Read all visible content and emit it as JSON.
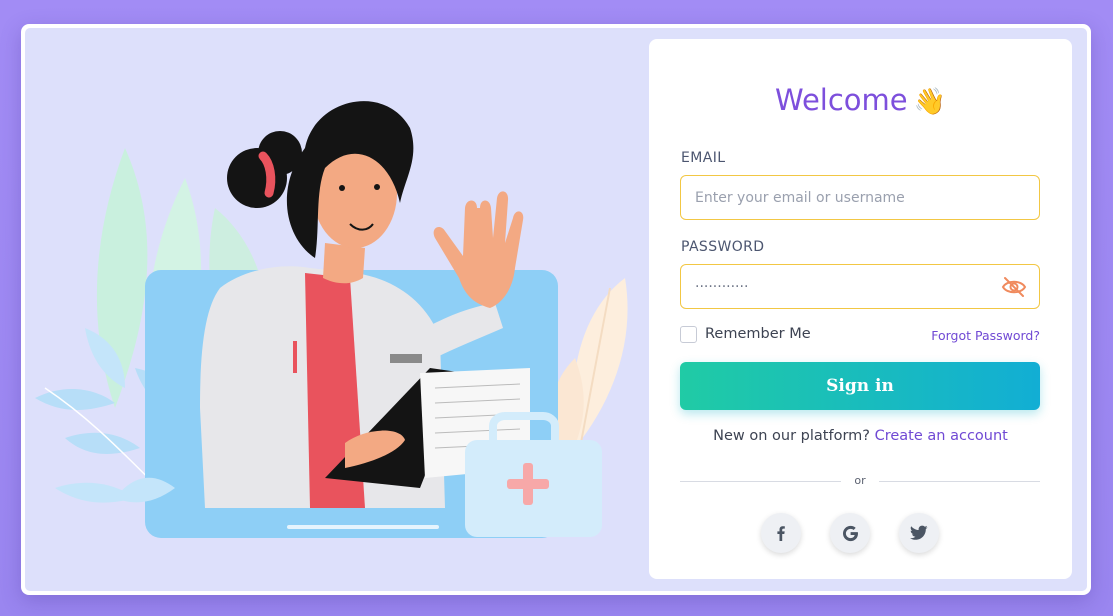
{
  "title": "Welcome",
  "title_emoji": "👋",
  "email": {
    "label": "EMAIL",
    "placeholder": "Enter your email or username",
    "value": ""
  },
  "password": {
    "label": "PASSWORD",
    "value": "············"
  },
  "remember_label": "Remember Me",
  "forgot_label": "Forgot Password?",
  "signin_label": "Sign in",
  "signup": {
    "prompt": "New on our platform?",
    "link": "Create an account"
  },
  "divider_text": "or",
  "social": [
    "facebook-icon",
    "google-icon",
    "twitter-icon"
  ],
  "colors": {
    "accent": "#7d4fdc",
    "field_border": "#f2c744",
    "button_start": "#20cba5",
    "button_end": "#12aed4",
    "background": "#a28cf5"
  }
}
